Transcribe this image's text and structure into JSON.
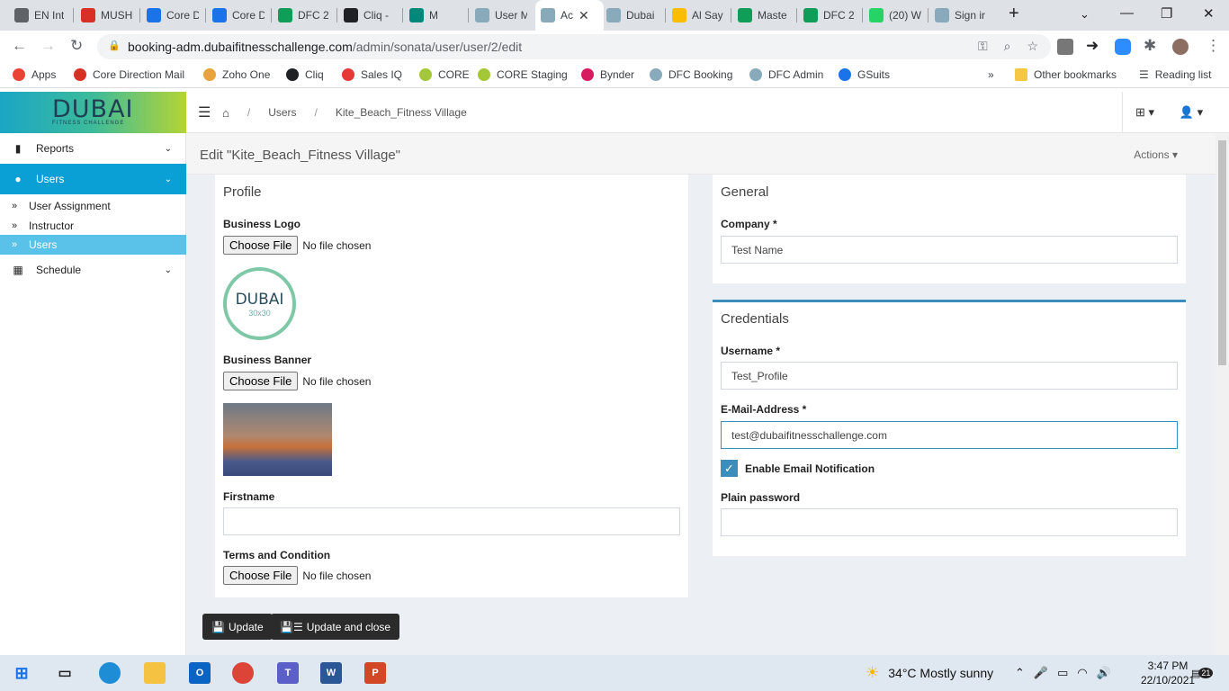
{
  "browser": {
    "tabs": [
      {
        "title": "EN Int",
        "color": "#5f6368"
      },
      {
        "title": "MUSH",
        "color": "#d93025"
      },
      {
        "title": "Core D",
        "color": "#1a73e8"
      },
      {
        "title": "Core D",
        "color": "#1a73e8"
      },
      {
        "title": "DFC 2",
        "color": "#0f9d58"
      },
      {
        "title": "Cliq -",
        "color": "#202124"
      },
      {
        "title": "M",
        "color": "#00897b"
      },
      {
        "title": "User M",
        "color": "#8ab"
      },
      {
        "title": "Ac",
        "color": "#8ab",
        "active": true
      },
      {
        "title": "Dubai",
        "color": "#8ab"
      },
      {
        "title": "Al Say",
        "color": "#fbbc04"
      },
      {
        "title": "Maste",
        "color": "#0f9d58"
      },
      {
        "title": "DFC 2",
        "color": "#0f9d58"
      },
      {
        "title": "(20) W",
        "color": "#25d366"
      },
      {
        "title": "Sign ir",
        "color": "#8ab"
      }
    ],
    "url_host": "booking-adm.dubaifitnesschallenge.com",
    "url_path": "/admin/sonata/user/user/2/edit",
    "bookmarks": [
      {
        "label": "Apps",
        "color": "#ea4335"
      },
      {
        "label": "Core Direction Mail",
        "color": "#d93025"
      },
      {
        "label": "Zoho One",
        "color": "#e8a33d"
      },
      {
        "label": "Cliq",
        "color": "#202124"
      },
      {
        "label": "Sales IQ",
        "color": "#e53935"
      },
      {
        "label": "CORE",
        "color": "#a4c639"
      },
      {
        "label": "CORE Staging",
        "color": "#a4c639"
      },
      {
        "label": "Bynder",
        "color": "#d81b60"
      },
      {
        "label": "DFC Booking",
        "color": "#8ab"
      },
      {
        "label": "DFC Admin",
        "color": "#8ab"
      },
      {
        "label": "GSuits",
        "color": "#1a73e8"
      }
    ],
    "more_bookmarks": "»",
    "other_bookmarks": "Other bookmarks",
    "reading_list": "Reading list"
  },
  "app": {
    "logo_text": "DUBAI",
    "logo_sub": "FITNESS CHALLENGE",
    "breadcrumb": [
      "Users",
      "Kite_Beach_Fitness Village"
    ],
    "sidebar": {
      "reports": "Reports",
      "users": "Users",
      "sub_items": [
        "User Assignment",
        "Instructor",
        "Users"
      ],
      "schedule": "Schedule"
    },
    "page_title": "Edit \"Kite_Beach_Fitness Village\"",
    "actions_label": "Actions",
    "profile": {
      "title": "Profile",
      "business_logo_label": "Business Logo",
      "choose_file": "Choose File",
      "no_file": "No file chosen",
      "logo_image_text": "DUBAI",
      "logo_image_sub": "30x30",
      "business_banner_label": "Business Banner",
      "firstname_label": "Firstname",
      "firstname_value": "",
      "terms_label": "Terms and Condition"
    },
    "general": {
      "title": "General",
      "company_label": "Company *",
      "company_value": "Test Name"
    },
    "credentials": {
      "title": "Credentials",
      "username_label": "Username *",
      "username_value": "Test_Profile",
      "email_label": "E-Mail-Address *",
      "email_value": "test@dubaifitnesschallenge.com",
      "notification_label": "Enable Email Notification",
      "notification_checked": true,
      "password_label": "Plain password",
      "password_value": ""
    },
    "buttons": {
      "update": "Update",
      "update_close": "Update and close"
    }
  },
  "taskbar": {
    "weather": "34°C  Mostly sunny",
    "time": "3:47 PM",
    "date": "22/10/2021",
    "notifications": "21"
  }
}
